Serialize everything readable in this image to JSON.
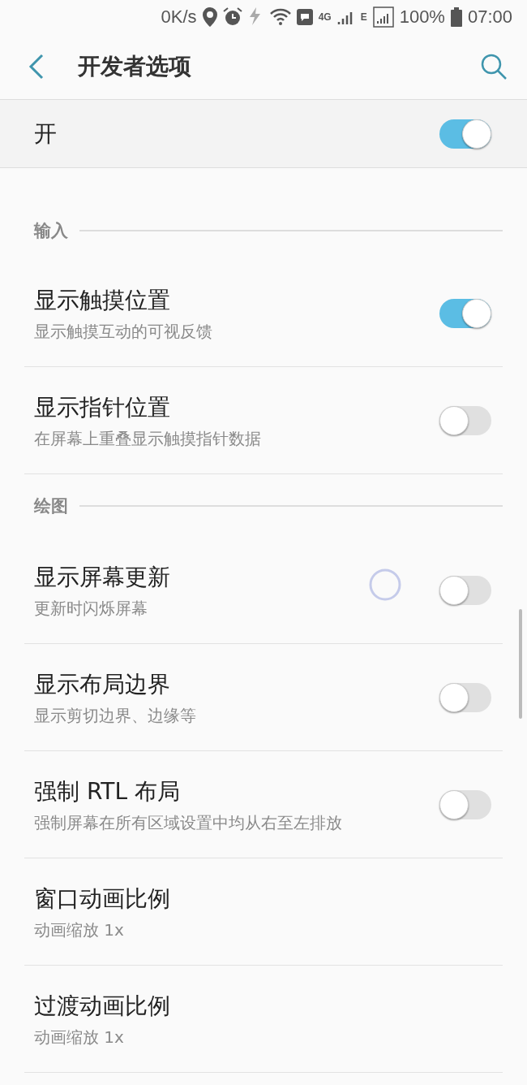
{
  "status_bar": {
    "speed": "0K/s",
    "network": "4G",
    "data_type": "E",
    "battery": "100%",
    "time": "07:00"
  },
  "header": {
    "title": "开发者选项"
  },
  "master_switch": {
    "label": "开",
    "on": true
  },
  "sections": [
    {
      "title": "输入",
      "items": [
        {
          "kind": "switch",
          "title": "显示触摸位置",
          "subtitle": "显示触摸互动的可视反馈",
          "on": true
        },
        {
          "kind": "switch",
          "title": "显示指针位置",
          "subtitle": "在屏幕上重叠显示触摸指针数据",
          "on": false
        }
      ]
    },
    {
      "title": "绘图",
      "items": [
        {
          "kind": "switch",
          "title": "显示屏幕更新",
          "subtitle": "更新时闪烁屏幕",
          "on": false
        },
        {
          "kind": "switch",
          "title": "显示布局边界",
          "subtitle": "显示剪切边界、边缘等",
          "on": false
        },
        {
          "kind": "switch",
          "title": "强制 RTL 布局",
          "subtitle": "强制屏幕在所有区域设置中均从右至左排放",
          "on": false
        },
        {
          "kind": "plain",
          "title": "窗口动画比例",
          "subtitle": "动画缩放 1x"
        },
        {
          "kind": "plain",
          "title": "过渡动画比例",
          "subtitle": "动画缩放 1x"
        }
      ]
    }
  ]
}
